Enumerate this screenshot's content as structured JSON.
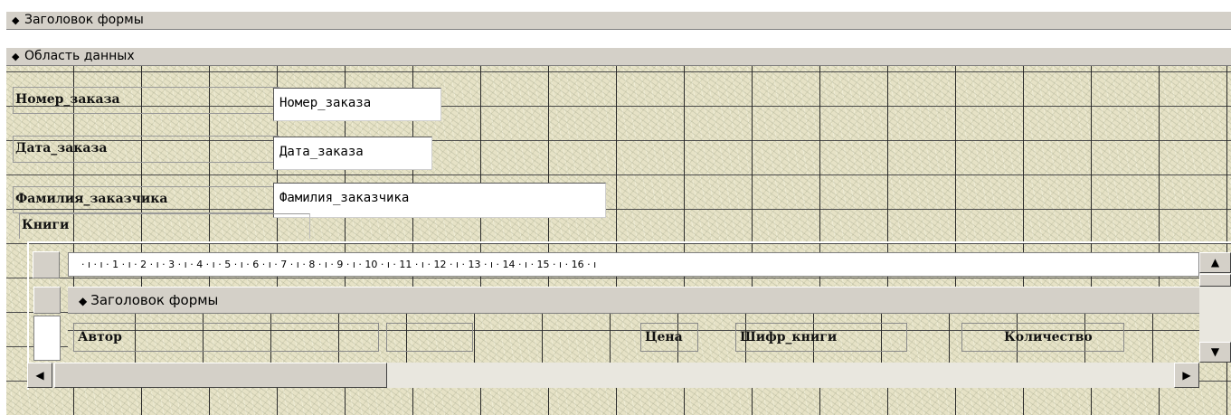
{
  "sections": {
    "form_header": "Заголовок формы",
    "detail": "Область данных"
  },
  "fields": [
    {
      "label": "Номер_заказа",
      "value": "Номер_заказа"
    },
    {
      "label": "Дата_заказа",
      "value": "Дата_заказа"
    },
    {
      "label": "Фамилия_заказчика",
      "value": "Фамилия_заказчика"
    }
  ],
  "subform": {
    "label": "Книги",
    "ruler_text": "· ı · ı · 1 · ı · 2 · ı · 3 · ı · 4 · ı · 5 · ı · 6 · ı · 7 · ı · 8 · ı · 9 · ı · 10 · ı · 11 · ı · 12 · ı · 13 · ı · 14 · ı · 15 · ı · 16 · ı",
    "header_section": "Заголовок формы",
    "columns": [
      "Автор",
      "Цена",
      "Шифр_книги",
      "Количество"
    ]
  },
  "icons": {
    "section_arrow": "section-arrow-icon",
    "scroll_up": "scroll-up-icon",
    "scroll_down": "scroll-down-icon",
    "scroll_left": "scroll-left-icon",
    "scroll_right": "scroll-right-icon"
  },
  "colors": {
    "chrome": "#d4d0c8",
    "texture": "#e6e2c6",
    "field_bg": "#ffffff"
  }
}
